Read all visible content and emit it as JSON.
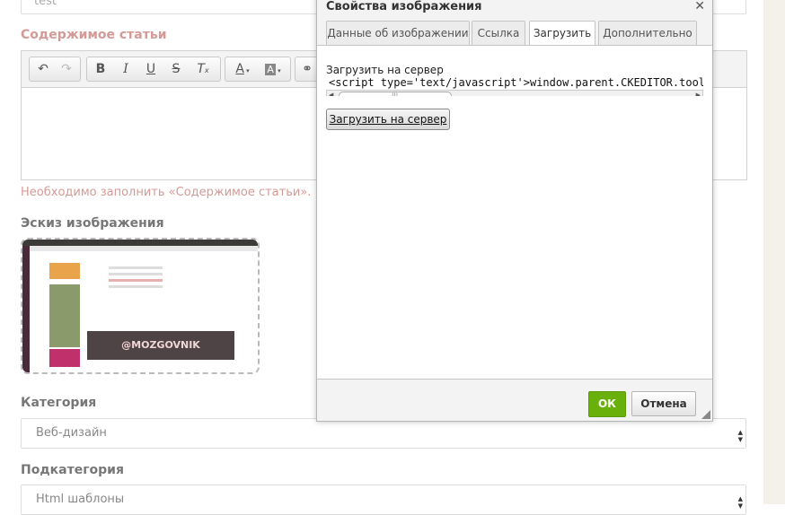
{
  "form": {
    "title_value": "test",
    "content_label": "Содержимое статьи",
    "content_error": "Необходимо заполнить «Содержимое статьи».",
    "thumb_label": "Эскиз изображения",
    "thumb_watermark": "@MOZGOVNIK",
    "category_label": "Категория",
    "category_value": "Веб-дизайн",
    "subcategory_label": "Подкатегория",
    "subcategory_value": "Html шаблоны"
  },
  "toolbar": {
    "icons": [
      "undo-icon",
      "redo-icon",
      "bold-icon",
      "italic-icon",
      "underline-icon",
      "strikethrough-icon",
      "remove-format-icon",
      "text-color-icon",
      "background-color-icon",
      "link-icon"
    ]
  },
  "dialog": {
    "title": "Свойства изображения",
    "close": "✕",
    "tabs": [
      "Данные об изображении",
      "Ссылка",
      "Загрузить",
      "Дополнительно"
    ],
    "active_tab": "Загрузить",
    "upload_label": "Загрузить на сервер",
    "response_code": "<script type='text/javascript'>window.parent.CKEDITOR.tools.",
    "upload_button": "Загрузить на сервер",
    "ok": "ОК",
    "cancel": "Отмена"
  },
  "colors": {
    "accent_pink": "#d49a96",
    "ok_green": "#69b10a"
  }
}
